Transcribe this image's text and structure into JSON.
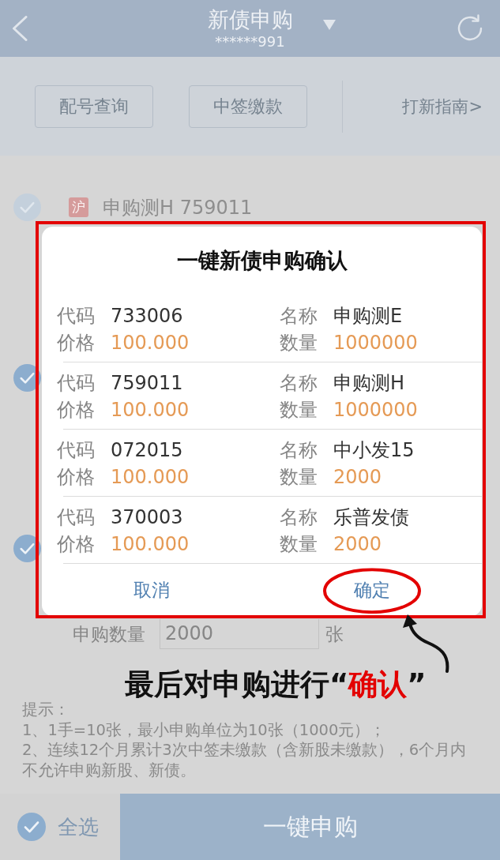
{
  "header": {
    "title": "新债申购",
    "account": "******991"
  },
  "toolbar": {
    "buttons": [
      "配号查询",
      "中签缴款"
    ],
    "guide_link": "打新指南>"
  },
  "bonds": [
    {
      "checked": true,
      "disabled": true,
      "market": "沪",
      "name": "申购测H 759011"
    },
    {
      "checked": true,
      "disabled": false
    },
    {
      "checked": true,
      "disabled": false,
      "quantity_label": "申购数量",
      "quantity": "2000",
      "unit": "张"
    }
  ],
  "notice": {
    "title": "提示：",
    "lines": [
      "1、1手=10张，最小申购单位为10张（1000元）；",
      "2、连续12个月累计3次中签未缴款（含新股未缴款），6个月内不允许申购新股、新债。"
    ]
  },
  "bottom_bar": {
    "select_all": {
      "label": "全选",
      "checked": true
    },
    "submit_button": "一键申购"
  },
  "dialog": {
    "title": "一键新债申购确认",
    "rows": [
      {
        "code_label": "代码",
        "code": "733006",
        "name_label": "名称",
        "name": "申购测E",
        "price_label": "价格",
        "price": "100.000",
        "amount_label": "数量",
        "amount": "1000000"
      },
      {
        "code_label": "代码",
        "code": "759011",
        "name_label": "名称",
        "name": "申购测H",
        "price_label": "价格",
        "price": "100.000",
        "amount_label": "数量",
        "amount": "1000000"
      },
      {
        "code_label": "代码",
        "code": "072015",
        "name_label": "名称",
        "name": "中小发15",
        "price_label": "价格",
        "price": "100.000",
        "amount_label": "数量",
        "amount": "2000"
      },
      {
        "code_label": "代码",
        "code": "370003",
        "name_label": "名称",
        "name": "乐普发债",
        "price_label": "价格",
        "price": "100.000",
        "amount_label": "数量",
        "amount": "2000"
      }
    ],
    "buttons": [
      {
        "label": "取消",
        "circled": false
      },
      {
        "label": "确定",
        "circled": true
      }
    ]
  },
  "annotation": {
    "lead": "最后对申购进行“",
    "emphasis": "确认",
    "tail": "”"
  }
}
